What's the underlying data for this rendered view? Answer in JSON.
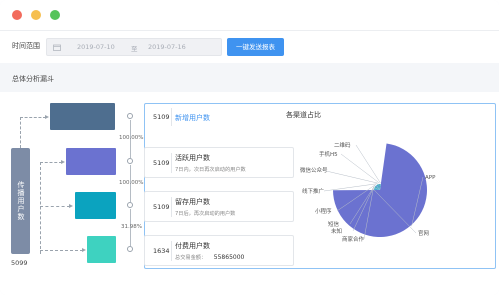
{
  "window": {
    "traffic_lights": [
      "close",
      "minimize",
      "maximize"
    ]
  },
  "toolbar": {
    "time_range_label": "时间范围",
    "date_start": "2019-07-10",
    "date_separator": "至",
    "date_end": "2019-07-16",
    "send_report_label": "一键发送报表"
  },
  "section": {
    "title": "总体分析漏斗"
  },
  "funnel": {
    "spread_label": "传播用户数",
    "spread_value": "5099",
    "percentages": [
      "100.00%",
      "100.00%",
      "31.98%"
    ],
    "stages": [
      {
        "value": "5109",
        "title": "新增用户数",
        "subtitle": ""
      },
      {
        "value": "5109",
        "title": "活跃用户数",
        "subtitle": "7日内，次日再次启动的用户数"
      },
      {
        "value": "5109",
        "title": "留存用户数",
        "subtitle": "7日后，再次启动的用户数"
      },
      {
        "value": "1634",
        "title": "付费用户数",
        "subtitle": "总交易金额：",
        "subtitle_value": "55865000"
      }
    ],
    "bar_colors": [
      "#4e6e8f",
      "#6b72d0",
      "#0ba3bf",
      "#3ed2c0"
    ]
  },
  "channel_chart": {
    "title": "各渠道占比",
    "chart_data": {
      "type": "pie",
      "title": "各渠道占比",
      "slices": [
        {
          "name": "APP",
          "value": 72.7,
          "color": "#6b72d0"
        },
        {
          "name": "官网",
          "value": 5.0,
          "color": "#4fa9d6"
        },
        {
          "name": "商家合作",
          "value": 3.0,
          "color": "#57c4c4"
        },
        {
          "name": "未知",
          "value": 2.5,
          "color": "#3aa2a6"
        },
        {
          "name": "短信",
          "value": 2.5,
          "color": "#4d8fcf"
        },
        {
          "name": "小程序",
          "value": 3.2,
          "color": "#6bb8e0"
        },
        {
          "name": "线下推广",
          "value": 3.2,
          "color": "#2e9fb8"
        },
        {
          "name": "微信公众号",
          "value": 3.0,
          "color": "#48b4c0"
        },
        {
          "name": "手机H5",
          "value": 2.5,
          "color": "#3a8fbf"
        },
        {
          "name": "二维码",
          "value": 2.4,
          "color": "#5fc2c8"
        }
      ]
    }
  }
}
